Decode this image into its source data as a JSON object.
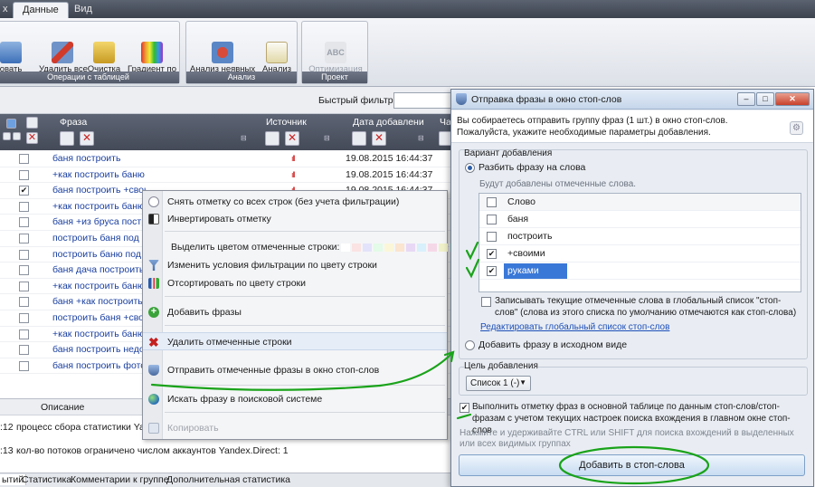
{
  "ribbon": {
    "tabs": [
      "х",
      "Данные",
      "Вид"
    ],
    "active_tab": "Данные",
    "groups": [
      {
        "label": "Операции с таблицей",
        "buttons": [
          {
            "label": "овать\nры"
          },
          {
            "label": "Удалить все\nфильтры"
          },
          {
            "label": "Очистка\nданных ▾"
          },
          {
            "label": "Градиент по\nзначениям ▾"
          }
        ]
      },
      {
        "label": "Анализ",
        "buttons": [
          {
            "label": "Анализ неявных\nдублей"
          },
          {
            "label": "Анализ\nгрупп"
          }
        ]
      },
      {
        "label": "Проект",
        "buttons": [
          {
            "label": "Оптимизация\nпроекта ▾"
          }
        ]
      }
    ]
  },
  "filter": {
    "label": "Быстрый фильтр:",
    "value": ""
  },
  "grid": {
    "columns": {
      "phrase": "Фраза",
      "source": "Источник",
      "date": "Дата добавлени",
      "extra": "Ча"
    },
    "rows": [
      {
        "checked": false,
        "phrase": "баня построить",
        "date": "19.08.2015 16:44:37",
        "src": "ıll"
      },
      {
        "checked": false,
        "phrase": "+как построить баню",
        "date": "19.08.2015 16:44:37",
        "src": "ıll"
      },
      {
        "checked": true,
        "phrase": "баня построить +своими",
        "date": "19.08.2015 16:44:37",
        "src": "ıll"
      },
      {
        "checked": false,
        "phrase": "+как построить баню",
        "date": "",
        "src": ""
      },
      {
        "checked": false,
        "phrase": "баня +из бруса постр",
        "date": "",
        "src": ""
      },
      {
        "checked": false,
        "phrase": "построить баня под кл",
        "date": "",
        "src": ""
      },
      {
        "checked": false,
        "phrase": "построить баню под ка",
        "date": "",
        "src": ""
      },
      {
        "checked": false,
        "phrase": "баня дача построить",
        "date": "",
        "src": ""
      },
      {
        "checked": false,
        "phrase": "+как построить баню",
        "date": "",
        "src": ""
      },
      {
        "checked": false,
        "phrase": "баня +как построить в",
        "date": "",
        "src": ""
      },
      {
        "checked": false,
        "phrase": "построить баня +свои",
        "date": "",
        "src": ""
      },
      {
        "checked": false,
        "phrase": "+как построить баню",
        "date": "",
        "src": ""
      },
      {
        "checked": false,
        "phrase": "баня построить недор",
        "date": "",
        "src": ""
      },
      {
        "checked": false,
        "phrase": "баня построить фото",
        "date": "",
        "src": ""
      }
    ]
  },
  "log": {
    "header": "Описание",
    "rows": [
      {
        "time": ":12",
        "text": "процесс сбора статистики Yandex"
      },
      {
        "time": ":13",
        "text": "кол-во потоков ограничено числом аккаунтов Yandex.Direct: 1"
      }
    ]
  },
  "bottom_tabs": [
    "ытий",
    "Статистика",
    "Комментарии к группе",
    "Дополнительная статистика"
  ],
  "context_menu": {
    "items": [
      {
        "label": "Снять отметку со всех строк (без учета фильтрации)",
        "icon": "uncheck-icon"
      },
      {
        "label": "Инвертировать отметку",
        "icon": "invert-icon"
      },
      {
        "label": "Выделить цветом отмеченные строки:",
        "icon": ""
      },
      {
        "label": "Изменить условия фильтрации по цвету строки",
        "icon": "filter-icon"
      },
      {
        "label": "Отсортировать по цвету строки",
        "icon": "sort-icon"
      },
      {
        "label": "Добавить фразы",
        "icon": "add-icon"
      },
      {
        "label": "Удалить отмеченные строки",
        "icon": "delete-icon"
      },
      {
        "label": "Отправить отмеченные фразы в окно стоп-слов",
        "icon": "shield-icon"
      },
      {
        "label": "Искать фразу в поисковой системе",
        "icon": "globe-icon"
      },
      {
        "label": "Копировать",
        "icon": "copy-icon"
      }
    ],
    "swatches": [
      "#ffffff",
      "#fbe3e3",
      "#e3e3fb",
      "#e3fbe8",
      "#fbf6d8",
      "#fbe5d0",
      "#e8d8f5",
      "#d8f0fb",
      "#f5d8e8",
      "#f0f0c8",
      "#d8fbf0",
      "#f7f7f7"
    ]
  },
  "dialog": {
    "title": "Отправка фразы в окно стоп-слов",
    "intro": "Вы собираетесь отправить группу фраз (1 шт.) в окно стоп-слов. Пожалуйста, укажите необходимые параметры добавления.",
    "variant_label": "Вариант добавления",
    "option_split": "Разбить фразу на слова",
    "split_hint": "Будут добавлены отмеченные слова.",
    "word_header": "Слово",
    "words": [
      {
        "word": "баня",
        "checked": false,
        "selected": false
      },
      {
        "word": "построить",
        "checked": false,
        "selected": false
      },
      {
        "word": "+своими",
        "checked": true,
        "selected": false
      },
      {
        "word": "руками",
        "checked": true,
        "selected": true
      }
    ],
    "global_check": "Записывать текущие отмеченные слова в глобальный список \"стоп-слов\" (слова из этого списка по умолчанию отмечаются как стоп-слова)",
    "edit_link": "Редактировать глобальный список стоп-слов",
    "option_original": "Добавить фразу в исходном виде",
    "target_label": "Цель добавления",
    "target_value": "Список 1 (-)",
    "mark_check": "Выполнить отметку фраз в основной таблице по данным стоп-слов/стоп-фразам с учетом текущих настроек поиска вхождения в главном окне стоп-слов",
    "tip": "Нажмите и удерживайте CTRL или SHIFT для поиска вхождений в выделенных или всех видимых группах",
    "submit": "Добавить в стоп-слова"
  }
}
